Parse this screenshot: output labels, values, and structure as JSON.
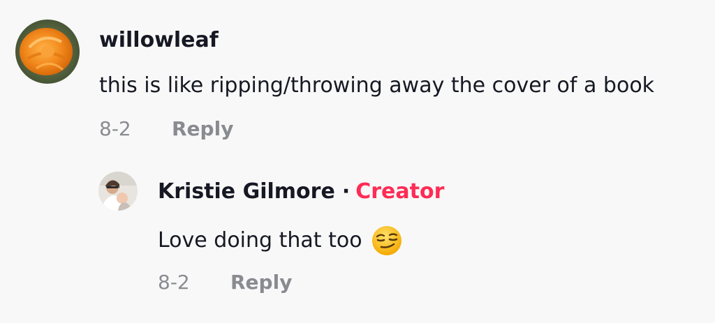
{
  "comment": {
    "username": "willowleaf",
    "text": "this is like ripping/throwing away the cover of a book",
    "date": "8-2",
    "reply_label": "Reply",
    "avatar_icon": "orange-rose-avatar"
  },
  "reply": {
    "username": "Kristie Gilmore",
    "separator": "·",
    "badge": "Creator",
    "text": "Love doing that too",
    "emoji_icon": "smirking-face-emoji",
    "date": "8-2",
    "reply_label": "Reply",
    "avatar_icon": "person-with-baby-avatar"
  },
  "colors": {
    "background": "#f8f8f8",
    "text": "#161823",
    "secondary": "#8a8b91",
    "creator_badge": "#fe2c55"
  }
}
